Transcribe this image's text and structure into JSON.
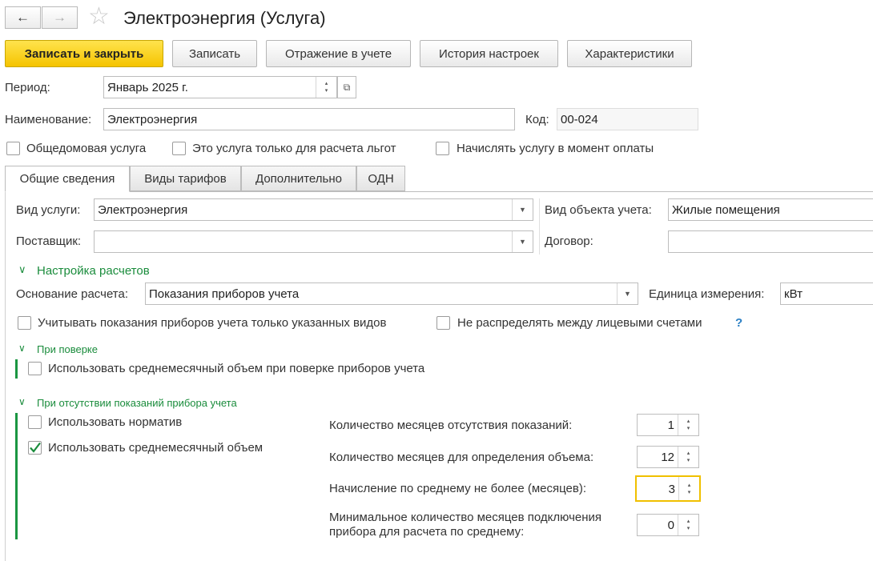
{
  "title": "Электроэнергия (Услуга)",
  "nav": {
    "back": "←",
    "forward": "→",
    "star": "☆"
  },
  "toolbar": {
    "save_close": "Записать и закрыть",
    "save": "Записать",
    "accounting": "Отражение в учете",
    "history": "История настроек",
    "characteristics": "Характеристики"
  },
  "period": {
    "label": "Период:",
    "value": "Январь 2025 г."
  },
  "name": {
    "label": "Наименование:",
    "value": "Электроэнергия"
  },
  "code": {
    "label": "Код:",
    "value": "00-024"
  },
  "flags": {
    "common_house": "Общедомовая услуга",
    "benefits_only": "Это услуга только для расчета льгот",
    "charge_on_payment": "Начислять услугу в момент оплаты"
  },
  "tabs": [
    "Общие сведения",
    "Виды тарифов",
    "Дополнительно",
    "ОДН"
  ],
  "general": {
    "service_type_label": "Вид услуги:",
    "service_type_value": "Электроэнергия",
    "supplier_label": "Поставщик:",
    "supplier_value": "",
    "object_type_label": "Вид объекта учета:",
    "object_type_value": "Жилые помещения",
    "contract_label": "Договор:",
    "contract_value": ""
  },
  "calc": {
    "section_title": "Настройка расчетов",
    "basis_label": "Основание расчета:",
    "basis_value": "Показания приборов учета",
    "unit_label": "Единица измерения:",
    "unit_value": "кВт",
    "only_specified": "Учитывать показания приборов учета только указанных видов",
    "no_distribute": "Не распределять между лицевыми счетами",
    "help": "?"
  },
  "verification": {
    "title": "При поверке",
    "use_average": "Использовать среднемесячный объем при поверке приборов учета"
  },
  "absence": {
    "title": "При отсутствии показаний прибора учета",
    "use_norm": "Использовать норматив",
    "use_average": "Использовать среднемесячный объем",
    "use_average_checked": true,
    "months_absent_label": "Количество месяцев отсутствия показаний:",
    "months_absent_value": "1",
    "months_volume_label": "Количество месяцев для определения объема:",
    "months_volume_value": "12",
    "max_months_label": "Начисление по среднему не более (месяцев):",
    "max_months_value": "3",
    "min_months_label_1": "Минимальное количество месяцев подключения",
    "min_months_label_2": "прибора для расчета по среднему:",
    "min_months_value": "0"
  },
  "colors": {
    "accent_green": "#1a8c3c",
    "primary_button": "#f5c400",
    "focus_border": "#f0c000"
  }
}
